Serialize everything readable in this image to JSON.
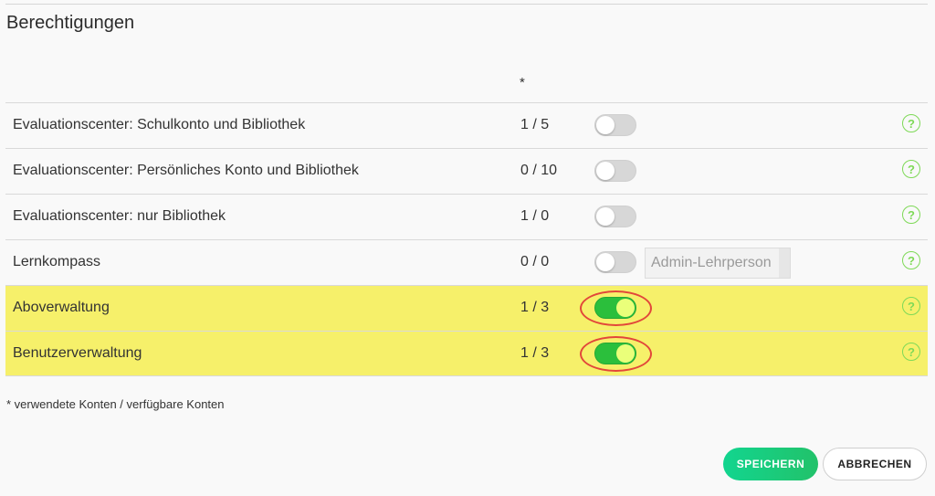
{
  "section": {
    "title": "Berechtigungen",
    "column_header": "*"
  },
  "permissions": [
    {
      "label": "Evaluationscenter: Schulkonto und Bibliothek",
      "count": "1 / 5",
      "enabled": false,
      "highlighted": false
    },
    {
      "label": "Evaluationscenter: Persönliches Konto und Bibliothek",
      "count": "0 / 10",
      "enabled": false,
      "highlighted": false
    },
    {
      "label": "Evaluationscenter: nur Bibliothek",
      "count": "1 / 0",
      "enabled": false,
      "highlighted": false
    },
    {
      "label": "Lernkompass",
      "count": "0 / 0",
      "enabled": false,
      "highlighted": false,
      "role_select": "Admin-Lehrperson"
    },
    {
      "label": "Aboverwaltung",
      "count": "1 / 3",
      "enabled": true,
      "highlighted": true
    },
    {
      "label": "Benutzerverwaltung",
      "count": "1 / 3",
      "enabled": true,
      "highlighted": true
    }
  ],
  "help_icon": {
    "glyph": "?",
    "icon": "question-circle-icon",
    "color": "#7ed957"
  },
  "footnote": "* verwendete Konten / verfügbare Konten",
  "actions": {
    "save_label": "SPEICHERN",
    "cancel_label": "ABBRECHEN"
  },
  "colors": {
    "highlight": "#f6f06a",
    "toggle_on": "#2bbf3c",
    "annotation_ring": "#e2473a",
    "save_button": "#12d58f"
  }
}
